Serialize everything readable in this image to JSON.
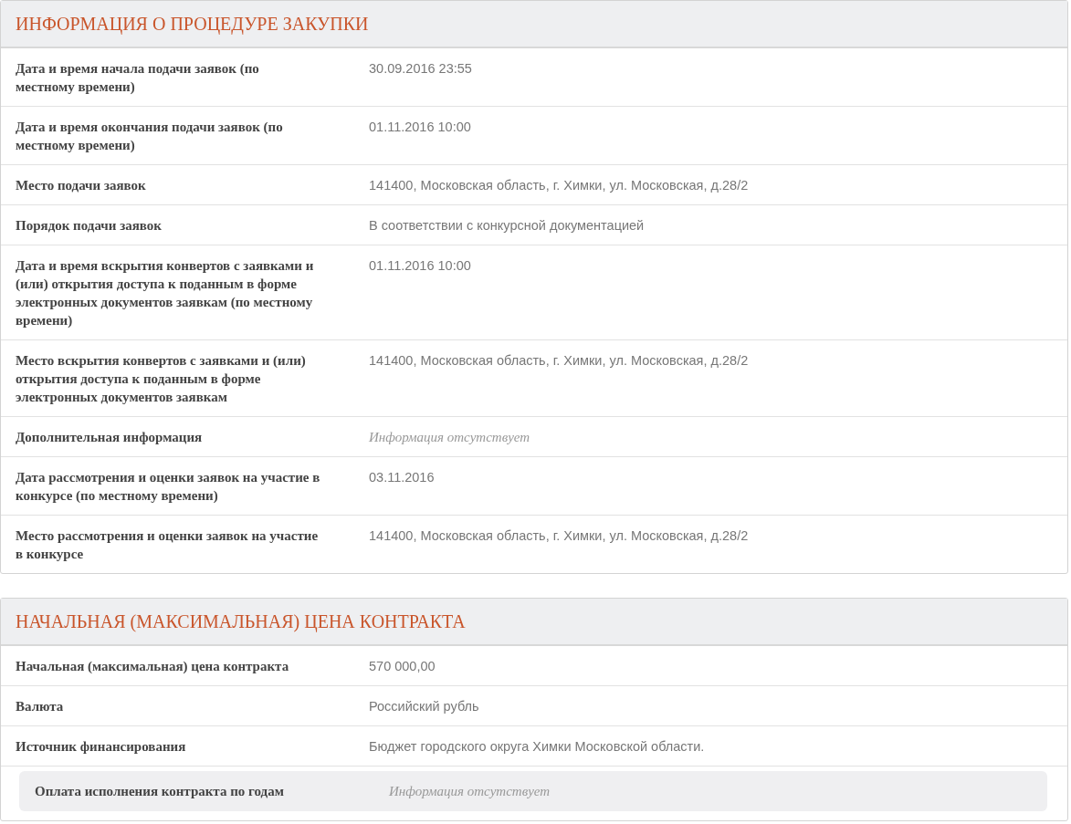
{
  "sections": [
    {
      "title": "ИНФОРМАЦИЯ О ПРОЦЕДУРЕ ЗАКУПКИ",
      "rows": [
        {
          "label": "Дата и время начала подачи заявок (по местному времени)",
          "value": "30.09.2016 23:55",
          "kind": "text"
        },
        {
          "label": "Дата и время окончания подачи заявок (по местному времени)",
          "value": "01.11.2016 10:00",
          "kind": "text"
        },
        {
          "label": "Место подачи заявок",
          "value": "141400, Московская область, г. Химки, ул. Московская, д.28/2",
          "kind": "text"
        },
        {
          "label": "Порядок подачи заявок",
          "value": "В соответствии с конкурсной документацией",
          "kind": "text"
        },
        {
          "label": "Дата и время вскрытия конвертов с заявками и (или) открытия доступа к поданным в форме электронных документов заявкам (по местному времени)",
          "value": "01.11.2016 10:00",
          "kind": "text"
        },
        {
          "label": "Место вскрытия конвертов с заявками и (или) открытия доступа к поданным в форме электронных документов заявкам",
          "value": "141400, Московская область, г. Химки, ул. Московская, д.28/2",
          "kind": "text"
        },
        {
          "label": "Дополнительная информация",
          "value": "Информация отсутствует",
          "kind": "missing"
        },
        {
          "label": "Дата рассмотрения и оценки заявок на участие в конкурсе (по местному времени)",
          "value": "03.11.2016",
          "kind": "text"
        },
        {
          "label": "Место рассмотрения и оценки заявок на участие в конкурсе",
          "value": "141400, Московская область, г. Химки, ул. Московская, д.28/2",
          "kind": "text"
        }
      ]
    },
    {
      "title": "НАЧАЛЬНАЯ (МАКСИМАЛЬНАЯ) ЦЕНА КОНТРАКТА",
      "rows": [
        {
          "label": "Начальная (максимальная) цена контракта",
          "value": "570 000,00",
          "kind": "text"
        },
        {
          "label": "Валюта",
          "value": "Российский рубль",
          "kind": "text"
        },
        {
          "label": "Источник финансирования",
          "value": "Бюджет городского округа Химки Московской области.",
          "kind": "text"
        }
      ],
      "subrows": [
        {
          "label": "Оплата исполнения контракта по годам",
          "value": "Информация отсутствует",
          "kind": "missing"
        }
      ]
    }
  ]
}
